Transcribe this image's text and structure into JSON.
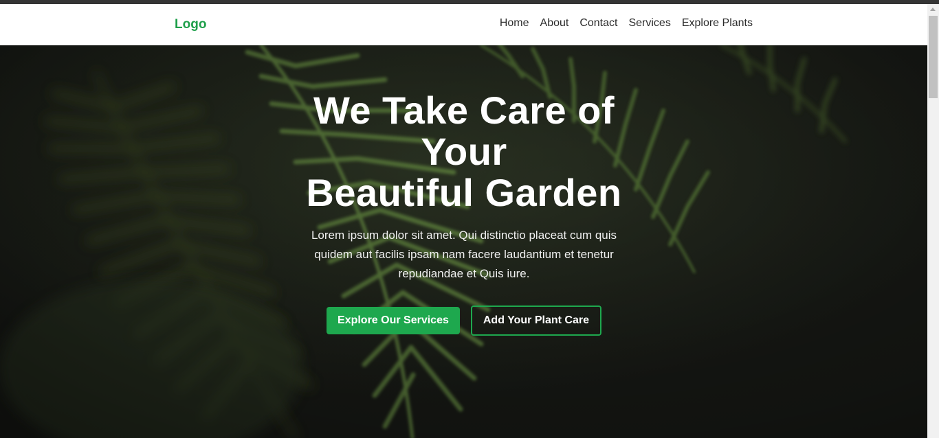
{
  "nav": {
    "logo": "Logo",
    "links": [
      "Home",
      "About",
      "Contact",
      "Services",
      "Explore Plants"
    ]
  },
  "hero": {
    "title_line1": "We Take Care of",
    "title_line2": "Your",
    "title_line3": "Beautiful Garden",
    "text": "Lorem ipsum dolor sit amet. Qui distinctio placeat cum quis quidem aut facilis ipsam nam facere laudantium et tenetur repudiandae et Quis iure.",
    "primary_button": "Explore Our Services",
    "secondary_button": "Add Your Plant Care"
  },
  "colors": {
    "accent": "#1ea84e",
    "logo": "#1e9f4a",
    "hero_background": "#1c1f1a"
  }
}
